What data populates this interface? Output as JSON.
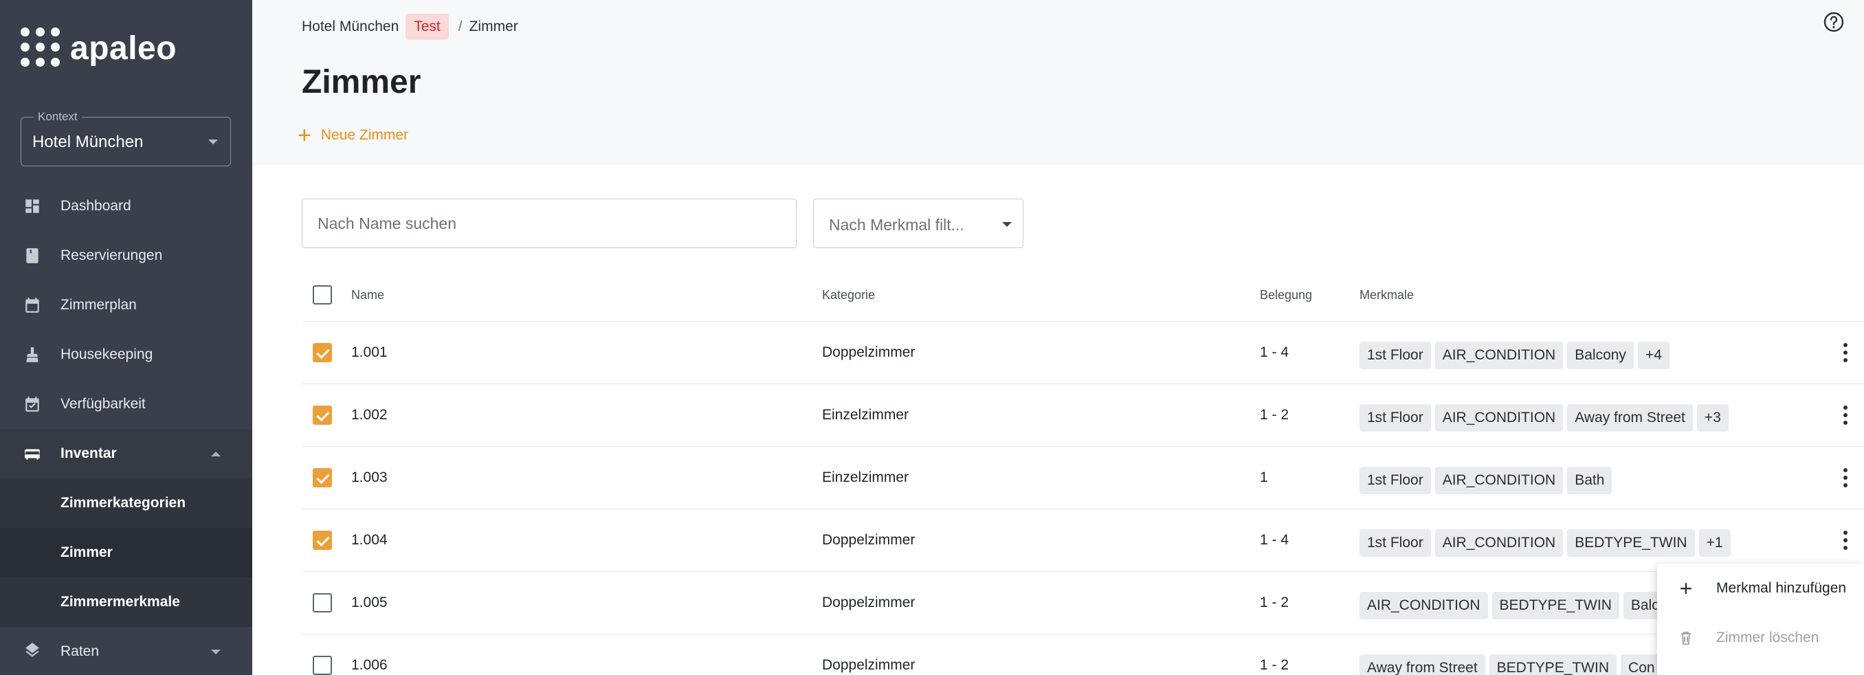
{
  "app": {
    "logo_text": "apaleo"
  },
  "context": {
    "label": "Kontext",
    "value": "Hotel München"
  },
  "nav": {
    "items": [
      {
        "label": "Dashboard",
        "icon": "dashboard-icon"
      },
      {
        "label": "Reservierungen",
        "icon": "book-icon"
      },
      {
        "label": "Zimmerplan",
        "icon": "calendar-icon"
      },
      {
        "label": "Housekeeping",
        "icon": "broom-icon"
      },
      {
        "label": "Verfügbarkeit",
        "icon": "calendar-check-icon"
      },
      {
        "label": "Inventar",
        "icon": "bed-icon",
        "expanded": true
      },
      {
        "label": "Raten",
        "icon": "layers-icon"
      }
    ],
    "inventory_sub": [
      {
        "label": "Zimmerkategorien"
      },
      {
        "label": "Zimmer",
        "selected": true
      },
      {
        "label": "Zimmermerkmale"
      }
    ]
  },
  "breadcrumb": {
    "hotel": "Hotel München",
    "badge": "Test",
    "separator": "/",
    "current": "Zimmer"
  },
  "page": {
    "title": "Zimmer",
    "add_label": "Neue Zimmer"
  },
  "search": {
    "placeholder": "Nach Name suchen",
    "value": ""
  },
  "filter": {
    "placeholder": "Nach Merkmal filt..."
  },
  "table": {
    "columns": [
      "Name",
      "Kategorie",
      "Belegung",
      "Merkmale"
    ],
    "rows": [
      {
        "checked": true,
        "name": "1.001",
        "category": "Doppelzimmer",
        "occupancy": "1 - 4",
        "features": [
          "1st Floor",
          "AIR_CONDITION",
          "Balcony",
          "+4"
        ]
      },
      {
        "checked": true,
        "name": "1.002",
        "category": "Einzelzimmer",
        "occupancy": "1 - 2",
        "features": [
          "1st Floor",
          "AIR_CONDITION",
          "Away from Street",
          "+3"
        ]
      },
      {
        "checked": true,
        "name": "1.003",
        "category": "Einzelzimmer",
        "occupancy": "1",
        "features": [
          "1st Floor",
          "AIR_CONDITION",
          "Bath"
        ]
      },
      {
        "checked": true,
        "name": "1.004",
        "category": "Doppelzimmer",
        "occupancy": "1 - 4",
        "features": [
          "1st Floor",
          "AIR_CONDITION",
          "BEDTYPE_TWIN",
          "+1"
        ]
      },
      {
        "checked": false,
        "name": "1.005",
        "category": "Doppelzimmer",
        "occupancy": "1 - 2",
        "features": [
          "AIR_CONDITION",
          "BEDTYPE_TWIN",
          "Balcony"
        ]
      },
      {
        "checked": false,
        "name": "1.006",
        "category": "Doppelzimmer",
        "occupancy": "1 - 2",
        "features": [
          "Away from Street",
          "BEDTYPE_TWIN",
          "Con"
        ]
      }
    ]
  },
  "context_menu": {
    "items": [
      {
        "label": "Merkmal hinzufügen",
        "icon": "plus-icon",
        "disabled": false
      },
      {
        "label": "Zimmer löschen",
        "icon": "trash-icon",
        "disabled": true
      }
    ]
  },
  "colors": {
    "accent": "#eba03a",
    "sidebar": "#3a404b",
    "badge_bg": "#fbd9d9",
    "badge_text": "#c5282f"
  }
}
